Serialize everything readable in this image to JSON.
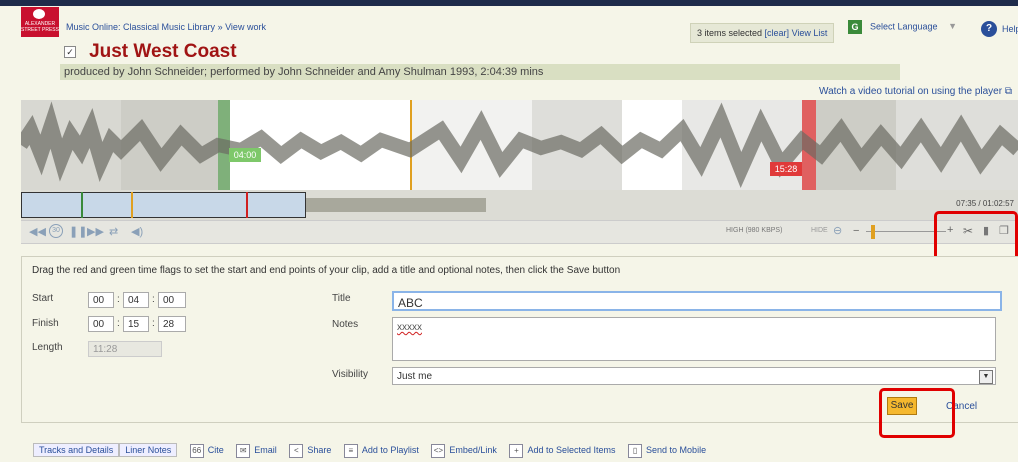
{
  "header": {
    "logo_text": "ALEXANDER STREET PRESS",
    "breadcrumb_root": "Music Online: Classical Music Library",
    "breadcrumb_sep": "»",
    "breadcrumb_current": "View work",
    "selection_text": "3 items selected",
    "clear_link": "[clear]",
    "view_list_link": "View List",
    "language_label": "Select Language",
    "help_label": "Help"
  },
  "work": {
    "title": "Just West Coast",
    "produced": "produced by John Schneider; performed by John Schneider and Amy Shulman 1993, 2:04:39 mins",
    "tutorial_link": "Watch a video tutorial on using the player"
  },
  "player": {
    "start_flag": "04:00",
    "end_flag": "15:28",
    "position": "07:35 / 01:02:57",
    "quality": "HIGH (980 KBPS)",
    "hide_label": "HIDE"
  },
  "clip_form": {
    "instructions": "Drag the red and green time flags to set the start and end points of your clip, add a title and optional notes, then click the Save button",
    "start_label": "Start",
    "start_h": "00",
    "start_m": "04",
    "start_s": "00",
    "finish_label": "Finish",
    "finish_h": "00",
    "finish_m": "15",
    "finish_s": "28",
    "length_label": "Length",
    "length_value": "11:28",
    "title_label": "Title",
    "title_value": "ABC",
    "notes_label": "Notes",
    "notes_value": "xxxxx",
    "visibility_label": "Visibility",
    "visibility_value": "Just me",
    "save_label": "Save",
    "cancel_label": "Cancel"
  },
  "bottom_bar": {
    "tab_tracks": "Tracks and Details",
    "tab_notes": "Liner Notes",
    "cite": "Cite",
    "email": "Email",
    "share": "Share",
    "playlist": "Add to Playlist",
    "embed": "Embed/Link",
    "add_selected": "Add to Selected Items",
    "send_mobile": "Send to Mobile"
  },
  "colors": {
    "accent_red": "#e00000",
    "title_red": "#a01414",
    "link_blue": "#2a4f9a",
    "save_orange": "#f5b82e"
  }
}
